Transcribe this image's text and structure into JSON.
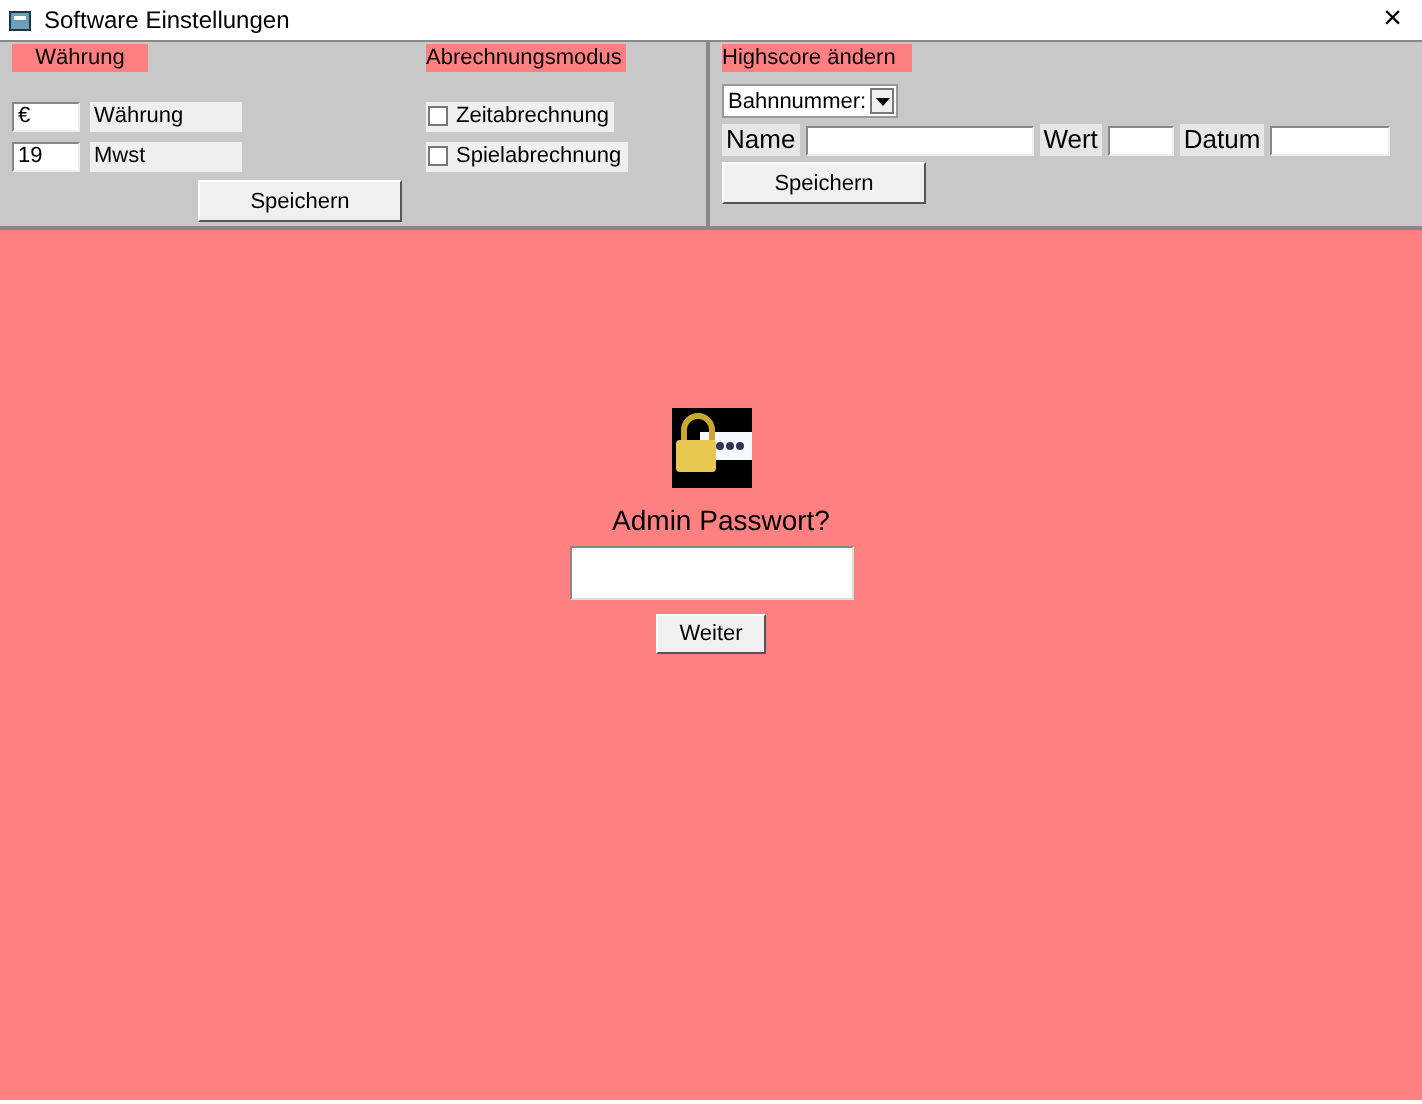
{
  "window": {
    "title": "Software Einstellungen",
    "close": "×"
  },
  "currency_panel": {
    "header": "Währung",
    "fields": [
      {
        "value": "€",
        "label": "Währung"
      },
      {
        "value": "19",
        "label": "Mwst"
      }
    ],
    "button": "Speichern"
  },
  "billing_panel": {
    "header": "Abrechnungsmodus",
    "options": [
      {
        "label": "Zeitabrechnung",
        "checked": false
      },
      {
        "label": "Spielabrechnung",
        "checked": false
      }
    ]
  },
  "highscore_panel": {
    "header": "Highscore ändern",
    "dropdown": "Bahnnummer:",
    "fields": [
      {
        "label": "Name"
      },
      {
        "label": "Wert"
      },
      {
        "label": "Datum"
      }
    ],
    "button": "Speichern"
  },
  "login": {
    "prompt": "Admin Passwort?",
    "button": "Weiter"
  }
}
